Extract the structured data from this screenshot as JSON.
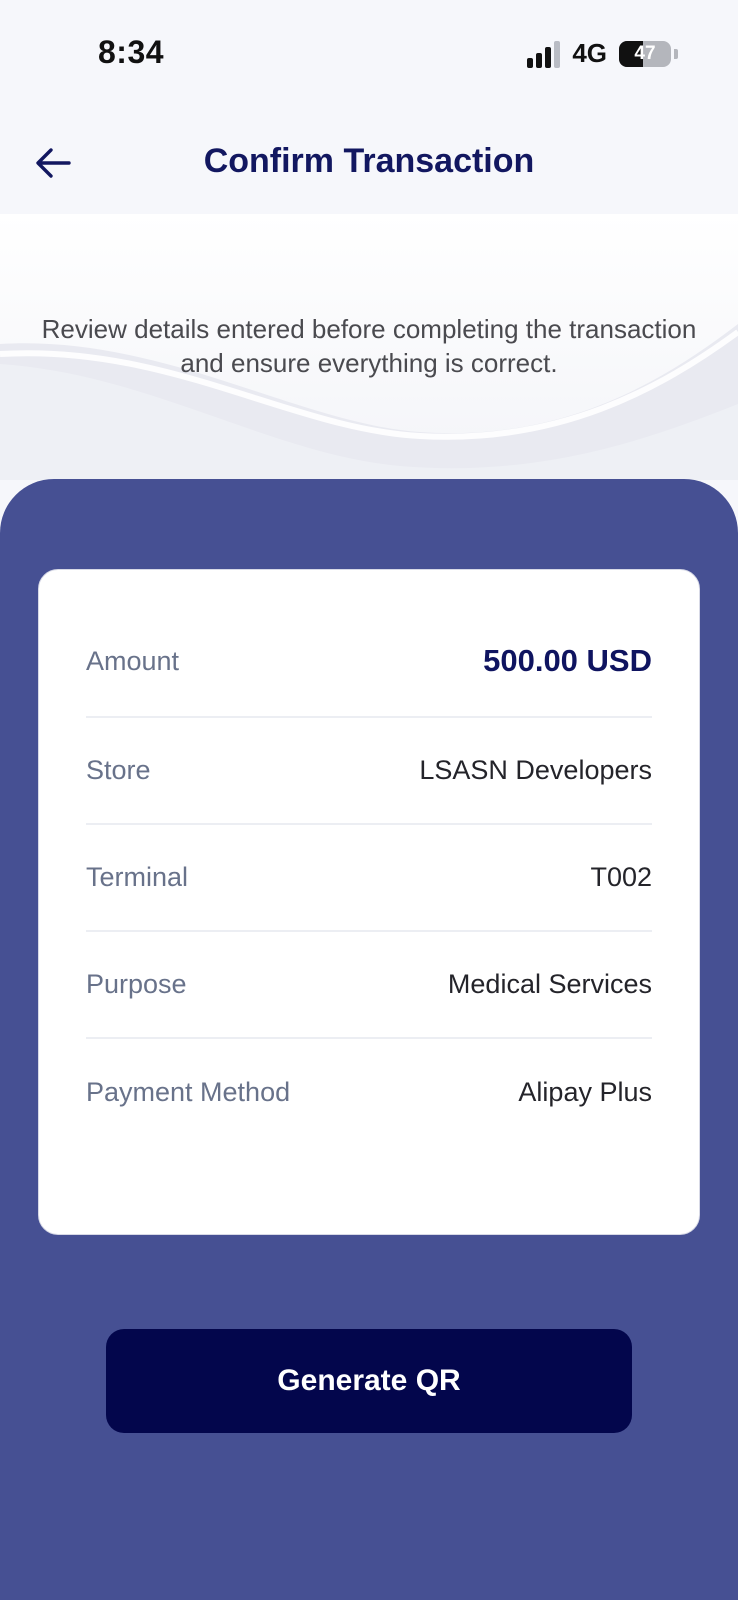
{
  "status_bar": {
    "time": "8:34",
    "network": "4G",
    "battery": "47",
    "battery_level": 0.47
  },
  "header": {
    "title": "Confirm Transaction",
    "back_icon": "arrow-left-icon"
  },
  "hero": {
    "description": "Review details entered before completing the transaction and ensure everything is correct."
  },
  "details": [
    {
      "label": "Amount",
      "value": "500.00 USD"
    },
    {
      "label": "Store",
      "value": "LSASN Developers"
    },
    {
      "label": "Terminal",
      "value": "T002"
    },
    {
      "label": "Purpose",
      "value": "Medical Services"
    },
    {
      "label": "Payment Method",
      "value": "Alipay Plus"
    }
  ],
  "actions": {
    "generate_label": "Generate QR"
  },
  "colors": {
    "panel": "#465093",
    "title": "#121760",
    "button": "#03064c",
    "amount": "#0f1460"
  }
}
